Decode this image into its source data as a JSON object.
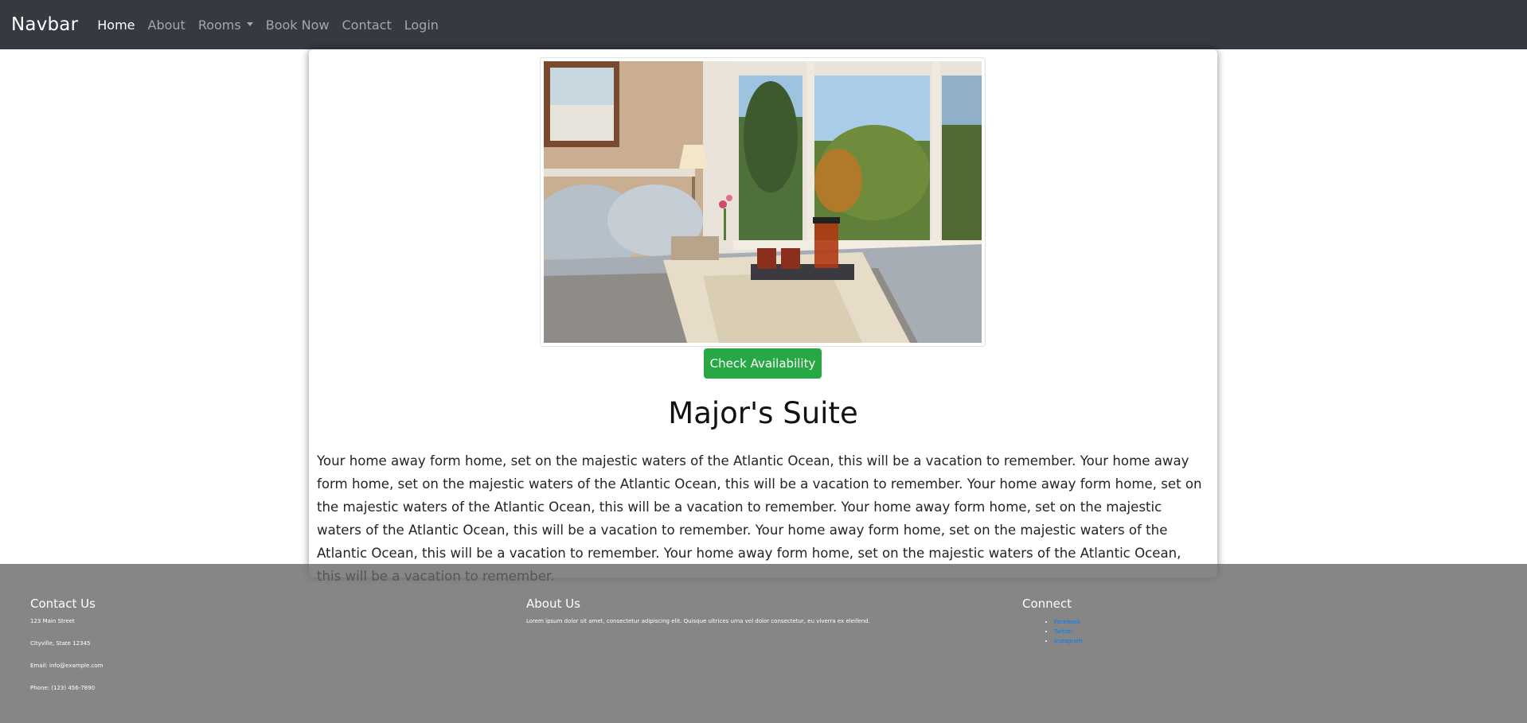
{
  "navbar": {
    "brand": "Navbar",
    "links": [
      {
        "label": "Home",
        "active": true
      },
      {
        "label": "About"
      },
      {
        "label": "Rooms",
        "dropdown": true
      },
      {
        "label": "Book Now"
      },
      {
        "label": "Contact"
      },
      {
        "label": "Login"
      }
    ]
  },
  "room": {
    "button_label": "Check Availability",
    "title": "Major's Suite",
    "description": "Your home away form home, set on the majestic waters of the Atlantic Ocean, this will be a vacation to remember. Your home away form home, set on the majestic waters of the Atlantic Ocean, this will be a vacation to remember. Your home away form home, set on the majestic waters of the Atlantic Ocean, this will be a vacation to remember. Your home away form home, set on the majestic waters of the Atlantic Ocean, this will be a vacation to remember. Your home away form home, set on the majestic waters of the Atlantic Ocean, this will be a vacation to remember. Your home away form home, set on the majestic waters of the Atlantic Ocean, this will be a vacation to remember."
  },
  "footer": {
    "contact": {
      "heading": "Contact Us",
      "street": "123 Main Street",
      "city": "Cityville, State 12345",
      "email": "Email: info@example.com",
      "phone": "Phone: (123) 456-7890"
    },
    "about": {
      "heading": "About Us",
      "text": "Lorem ipsum dolor sit amet, consectetur adipiscing elit. Quisque ultrices urna vel dolor consectetur, eu viverra ex eleifend."
    },
    "connect": {
      "heading": "Connect",
      "links": [
        "Facebook",
        "Twitter",
        "Instagram"
      ]
    }
  },
  "colors": {
    "navbar_bg": "#343a40",
    "button_green": "#28a745",
    "link_blue": "#007bff",
    "footer_bg": "#646464"
  }
}
